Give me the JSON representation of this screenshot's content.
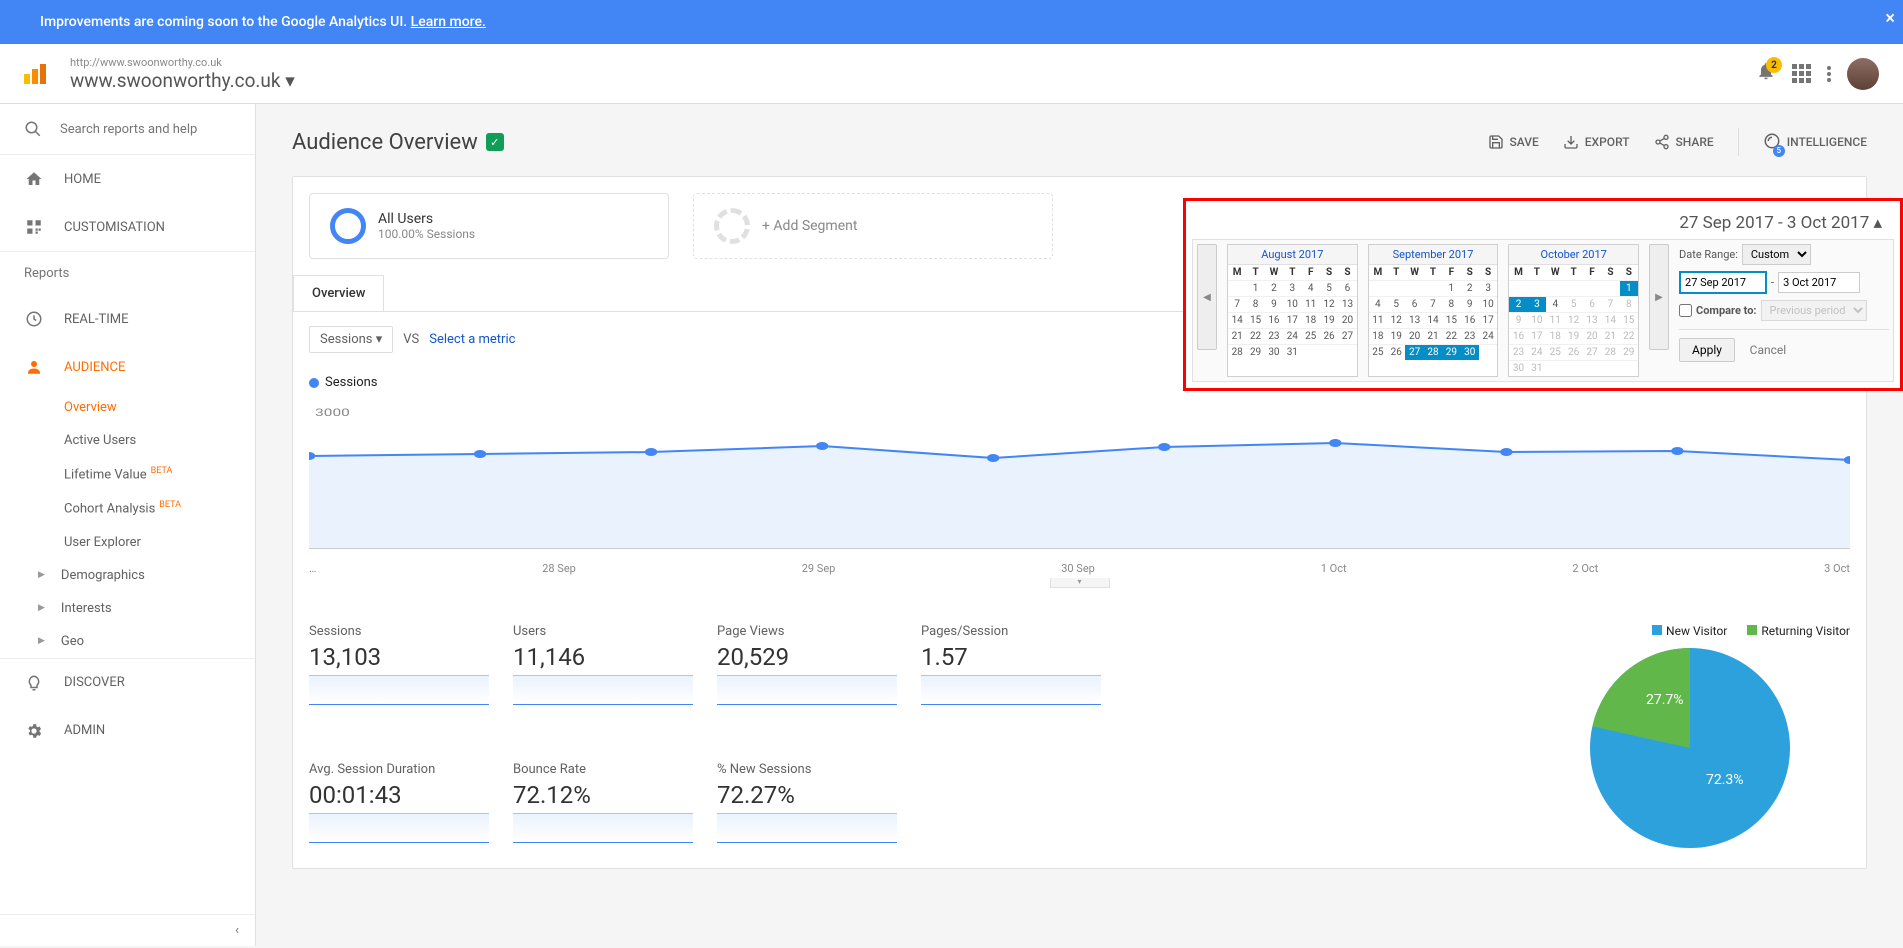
{
  "banner": {
    "text": "Improvements are coming soon to the Google Analytics UI.",
    "link": "Learn more."
  },
  "header": {
    "url": "http://www.swoonworthy.co.uk",
    "site": "www.swoonworthy.co.uk",
    "notifications": "2"
  },
  "sidebar": {
    "search_placeholder": "Search reports and help",
    "items": {
      "home": "HOME",
      "customisation": "CUSTOMISATION",
      "reports": "Reports",
      "realtime": "REAL-TIME",
      "audience": "AUDIENCE",
      "discover": "DISCOVER",
      "admin": "ADMIN"
    },
    "audience_sub": {
      "overview": "Overview",
      "active": "Active Users",
      "lifetime": "Lifetime Value",
      "lifetime_beta": "BETA",
      "cohort": "Cohort Analysis",
      "cohort_beta": "BETA",
      "explorer": "User Explorer",
      "demographics": "Demographics",
      "interests": "Interests",
      "geo": "Geo"
    }
  },
  "page": {
    "title": "Audience Overview",
    "save": "SAVE",
    "export": "EXPORT",
    "share": "SHARE",
    "intelligence": "INTELLIGENCE",
    "intel_count": "5"
  },
  "segments": {
    "all_users": "All Users",
    "sessions_pct": "100.00% Sessions",
    "add": "+ Add Segment"
  },
  "tab": "Overview",
  "controls": {
    "sessions": "Sessions",
    "vs": "VS",
    "select_metric": "Select a metric",
    "legend": "Sessions"
  },
  "date_panel": {
    "range_text": "27 Sep 2017 - 3 Oct 2017",
    "label": "Date Range:",
    "custom": "Custom",
    "from": "27 Sep 2017",
    "to": "3 Oct 2017",
    "dash": "-",
    "compare": "Compare to:",
    "previous": "Previous period",
    "apply": "Apply",
    "cancel": "Cancel",
    "months": {
      "aug": "August 2017",
      "sep": "September 2017",
      "oct": "October 2017"
    },
    "dow": "MTWTFSS"
  },
  "chart_data": {
    "type": "line",
    "categories": [
      "…",
      "28 Sep",
      "29 Sep",
      "30 Sep",
      "1 Oct",
      "2 Oct",
      "3 Oct"
    ],
    "series": [
      {
        "name": "Sessions",
        "values": [
          1870,
          1900,
          1940,
          2050,
          1840,
          2040,
          2110,
          1950,
          1960,
          1800
        ]
      }
    ],
    "y_ticks": [
      1500,
      3000
    ],
    "ylim": [
      0,
      3000
    ]
  },
  "metrics": [
    {
      "label": "Sessions",
      "value": "13,103"
    },
    {
      "label": "Users",
      "value": "11,146"
    },
    {
      "label": "Page Views",
      "value": "20,529"
    },
    {
      "label": "Pages/Session",
      "value": "1.57"
    },
    {
      "label": "Avg. Session Duration",
      "value": "00:01:43"
    },
    {
      "label": "Bounce Rate",
      "value": "72.12%"
    },
    {
      "label": "% New Sessions",
      "value": "72.27%"
    }
  ],
  "pie": {
    "legend": {
      "new": "New Visitor",
      "returning": "Returning Visitor"
    },
    "new_pct": "72.3%",
    "ret_pct": "27.7%",
    "colors": {
      "new": "#2ca1db",
      "returning": "#62b74a"
    }
  }
}
